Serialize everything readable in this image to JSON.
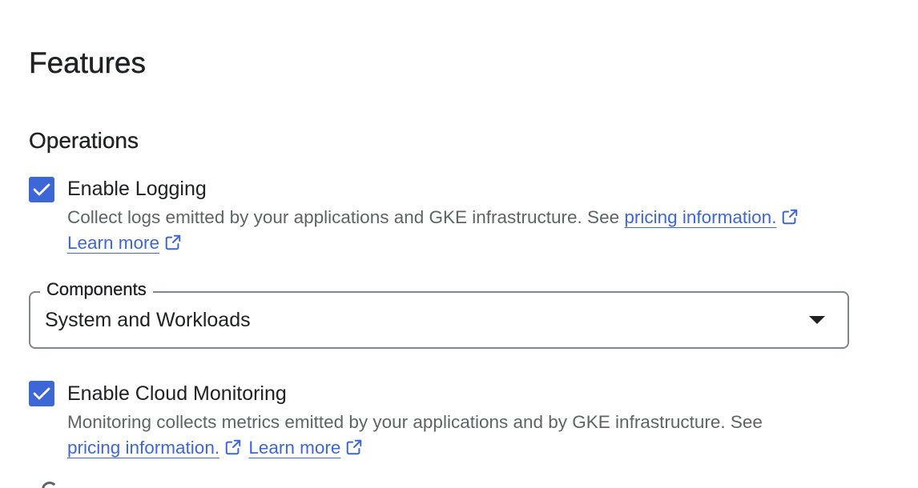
{
  "page": {
    "title": "Features"
  },
  "operations": {
    "section_title": "Operations",
    "logging": {
      "checked": true,
      "label": "Enable Logging",
      "description": "Collect logs emitted by your applications and GKE infrastructure. See ",
      "pricing_link": "pricing information.",
      "learn_more_link": "Learn more"
    },
    "components": {
      "label": "Components",
      "value": "System and Workloads"
    },
    "monitoring": {
      "checked": true,
      "label": "Enable Cloud Monitoring",
      "description": "Monitoring collects metrics emitted by your applications and by GKE infrastructure. See",
      "pricing_link": "pricing information.",
      "learn_more_link": "Learn more"
    }
  },
  "theme": {
    "accent": "#3d67d6",
    "text_primary": "#202124",
    "text_secondary": "#5f6368",
    "border": "#80868b"
  }
}
